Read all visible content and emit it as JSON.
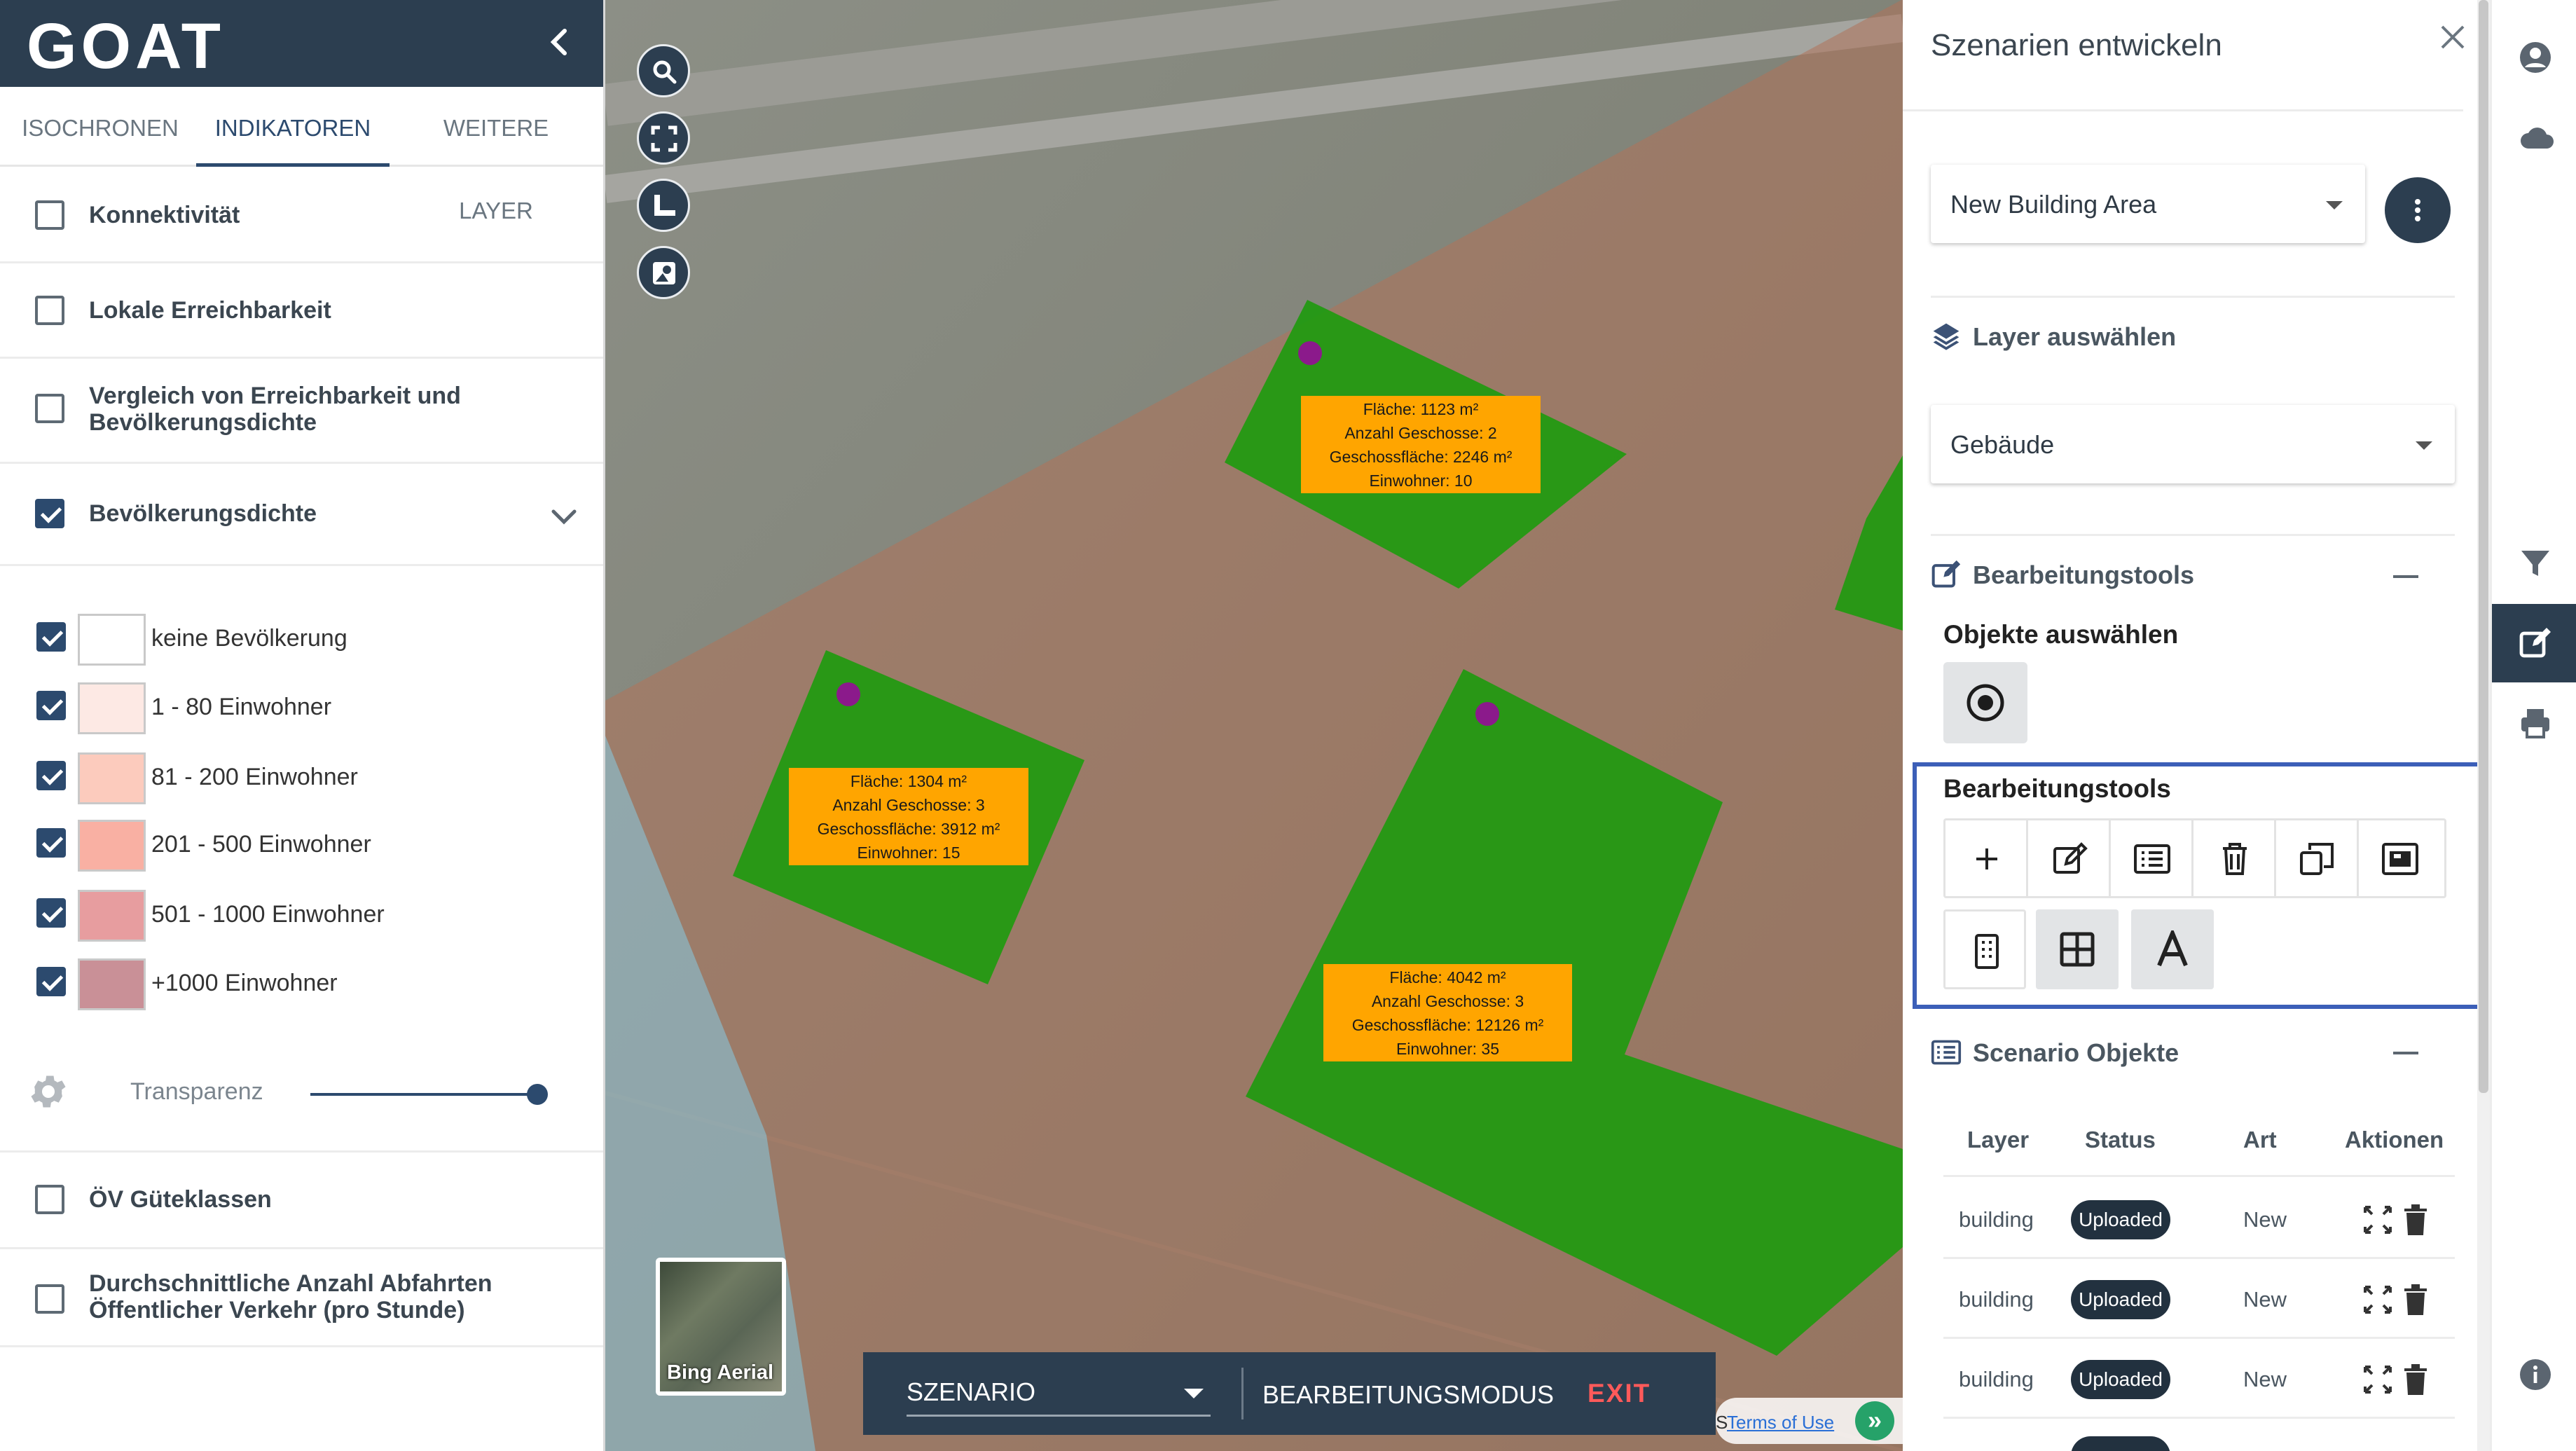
{
  "app": {
    "logo": "GOAT"
  },
  "left_panel": {
    "tabs": [
      {
        "label": "ISOCHRONEN",
        "active": false
      },
      {
        "label": "INDIKATOREN",
        "active": true
      },
      {
        "label": "WEITERE LAYER",
        "active": false
      }
    ],
    "indicators": [
      {
        "label": "Konnektivität",
        "checked": false
      },
      {
        "label": "Lokale Erreichbarkeit",
        "checked": false
      },
      {
        "label_line1": "Vergleich von Erreichbarkeit und",
        "label_line2": "Bevölkerungsdichte",
        "checked": false
      },
      {
        "label": "Bevölkerungsdichte",
        "checked": true,
        "expanded": true
      },
      {
        "label": "ÖV Güteklassen",
        "checked": false
      },
      {
        "label_line1": "Durchschnittliche Anzahl Abfahrten",
        "label_line2": "Öffentlicher Verkehr (pro Stunde)",
        "checked": false
      }
    ],
    "legend": [
      {
        "label": "keine Bevölkerung",
        "color": "#ffffff",
        "checked": true
      },
      {
        "label": "1 - 80 Einwohner",
        "color": "#fde9e4",
        "checked": true
      },
      {
        "label": "81 - 200 Einwohner",
        "color": "#fccbbd",
        "checked": true
      },
      {
        "label": "201 - 500 Einwohner",
        "color": "#f9b0a3",
        "checked": true
      },
      {
        "label": "501 - 1000 Einwohner",
        "color": "#e79d9f",
        "checked": true
      },
      {
        "label": "+1000 Einwohner",
        "color": "#c99097",
        "checked": true
      }
    ],
    "transparency": {
      "label": "Transparenz",
      "value": 1.0
    }
  },
  "map": {
    "labels": [
      {
        "flaeche": "Fläche: 1123 m²",
        "geschosse": "Anzahl Geschosse: 2",
        "geschossflaeche": "Geschossfläche: 2246 m²",
        "einwohner": "Einwohner: 10"
      },
      {
        "flaeche": "Fläche: 1304 m²",
        "geschosse": "Anzahl Geschosse: 3",
        "geschossflaeche": "Geschossfläche: 3912 m²",
        "einwohner": "Einwohner: 15"
      },
      {
        "flaeche": "Fläche: 4042 m²",
        "geschosse": "Anzahl Geschosse: 3",
        "geschossflaeche": "Geschossfläche: 12126 m²",
        "einwohner": "Einwohner: 35"
      }
    ],
    "basemap_label": "Bing Aerial",
    "scenario_bar": {
      "scenario_label": "SZENARIO",
      "mode_label": "BEARBEITUNGSMODUS",
      "exit_label": "EXIT"
    },
    "attribution": {
      "partial": "S",
      "terms": "Terms of Use",
      "toggle": "»"
    },
    "colors": {
      "building": "#1f9a0f",
      "population_overlay": "#b0735a",
      "label_bg": "#ffa500",
      "vertex": "#8b1a8b"
    }
  },
  "right_panel": {
    "title": "Szenarien entwickeln",
    "scenario_select": "New Building Area",
    "layer_section": {
      "title": "Layer auswählen",
      "value": "Gebäude"
    },
    "edit_section": {
      "title": "Bearbeitungstools",
      "select_objects_label": "Objekte auswählen",
      "tools_label": "Bearbeitungstools",
      "tools_row1": [
        "plus-icon",
        "edit-icon",
        "list-icon",
        "trash-icon",
        "copy-icon",
        "image-icon"
      ],
      "tools_row2": [
        "building-icon",
        "grid-icon",
        "text-icon"
      ]
    },
    "objects_section": {
      "title": "Scenario Objekte",
      "headers": [
        "Layer",
        "Status",
        "Art",
        "Aktionen"
      ],
      "rows": [
        {
          "layer": "building",
          "status": "Uploaded",
          "art": "New"
        },
        {
          "layer": "building",
          "status": "Uploaded",
          "art": "New"
        },
        {
          "layer": "building",
          "status": "Uploaded",
          "art": "New"
        }
      ]
    }
  },
  "rail": {
    "icons": [
      "account-icon",
      "cloud-icon",
      "filter-icon",
      "edit-scenario-icon",
      "print-icon",
      "info-icon"
    ],
    "accent": "#2c3e50"
  }
}
